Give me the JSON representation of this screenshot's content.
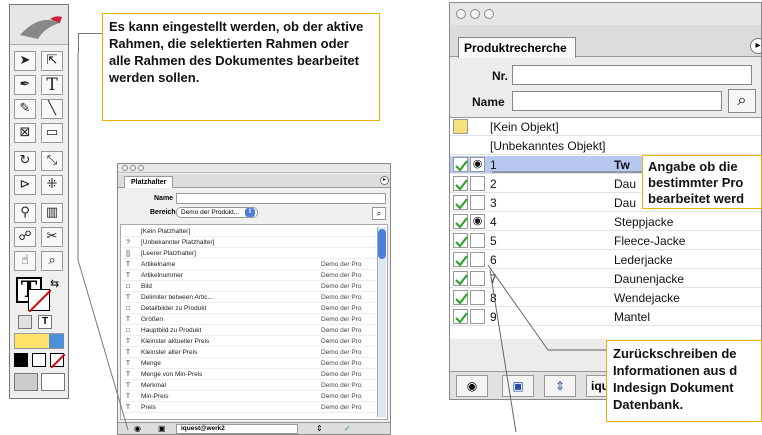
{
  "callouts": {
    "top_left": "Es kann eingestellt werden, ob der aktive Rahmen, die selektierten Rahmen oder alle Rahmen des Dokumentes bearbeitet werden sollen.",
    "right_top": "Angabe ob die bestimmter Pro bearbeitet werd",
    "right_bottom": "Zurückschreiben de Informationen aus d Indesign Dokument Datenbank."
  },
  "small_palette": {
    "tab": "Platzhalter",
    "name_label": "Name",
    "bereich_label": "Bereich",
    "bereich_value": "Demo der Produkt...",
    "bottom_field": "iquest@werk2",
    "rows": [
      {
        "icon": "",
        "name": "[Kein Platzhalter]",
        "value": ""
      },
      {
        "icon": "?",
        "name": "[Unbekannter Platzhalter]",
        "value": ""
      },
      {
        "icon": "[]",
        "name": "[Leerer Platzhalter]",
        "value": ""
      },
      {
        "icon": "T",
        "name": "Artikelname",
        "value": "Demo der Pro"
      },
      {
        "icon": "T",
        "name": "Artikelnummer",
        "value": "Demo der Pro"
      },
      {
        "icon": "□",
        "name": "Bild",
        "value": "Demo der Pro"
      },
      {
        "icon": "T",
        "name": "Delimiter between Artic...",
        "value": "Demo der Pro"
      },
      {
        "icon": "□",
        "name": "Detailbilder zu Produkt",
        "value": "Demo der Pro"
      },
      {
        "icon": "T",
        "name": "Größen",
        "value": "Demo der Pro"
      },
      {
        "icon": "□",
        "name": "Hauptbild zu Produkt",
        "value": "Demo der Pro"
      },
      {
        "icon": "T",
        "name": "Kleinster aktueller Preis",
        "value": "Demo der Pro"
      },
      {
        "icon": "T",
        "name": "Kleinster alter Preis",
        "value": "Demo der Pro"
      },
      {
        "icon": "T",
        "name": "Menge",
        "value": "Demo der Pro"
      },
      {
        "icon": "T",
        "name": "Menge von Min-Preis",
        "value": "Demo der Pro"
      },
      {
        "icon": "T",
        "name": "Merkmal",
        "value": "Demo der Pro"
      },
      {
        "icon": "T",
        "name": "Min-Preis",
        "value": "Demo der Pro"
      },
      {
        "icon": "T",
        "name": "Preis",
        "value": "Demo der Pro"
      }
    ]
  },
  "big_palette": {
    "tab": "Produktrecherche",
    "nr_label": "Nr.",
    "name_label": "Name",
    "bottom_field": "iqu",
    "rows": [
      {
        "label": "[Kein Objekt]",
        "value": ""
      },
      {
        "label": "[Unbekanntes Objekt]",
        "value": ""
      },
      {
        "label": "1",
        "value": "Tw"
      },
      {
        "label": "2",
        "value": "Dau"
      },
      {
        "label": "3",
        "value": "Dau"
      },
      {
        "label": "4",
        "value": "Steppjacke"
      },
      {
        "label": "5",
        "value": "Fleece-Jacke"
      },
      {
        "label": "6",
        "value": "Lederjacke"
      },
      {
        "label": "7",
        "value": "Daunenjacke"
      },
      {
        "label": "8",
        "value": "Wendejacke"
      },
      {
        "label": "9",
        "value": "Mantel"
      }
    ]
  },
  "colors": {
    "callout_border": "#e8b400",
    "check": "#2fa52f",
    "selection": "#b8c8f0"
  }
}
